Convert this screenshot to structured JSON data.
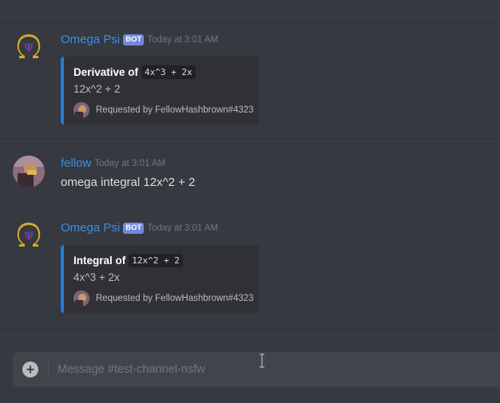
{
  "messages": [
    {
      "author": "Omega Psi",
      "badge": "BOT",
      "timestamp": "Today at 3:01 AM",
      "embed": {
        "title_prefix": "Derivative of",
        "title_code": "4x^3 + 2x",
        "description": "12x^2 + 2",
        "footer": "Requested by FellowHashbrown#4323"
      }
    },
    {
      "author": "fellow",
      "timestamp": "Today at 3:01 AM",
      "content": "omega integral 12x^2 + 2"
    },
    {
      "author": "Omega Psi",
      "badge": "BOT",
      "timestamp": "Today at 3:01 AM",
      "embed": {
        "title_prefix": "Integral of",
        "title_code": "12x^2 + 2",
        "description": "4x^3 + 2x",
        "footer": "Requested by FellowHashbrown#4323"
      }
    }
  ],
  "composer": {
    "placeholder": "Message #test-channel-nsfw",
    "add_icon": "+"
  },
  "colors": {
    "background": "#36393f",
    "author_blue": "#3a8ee6",
    "bot_badge": "#7289da",
    "embed_border": "#1e7fd8",
    "omega_gold": "#d6a82e"
  }
}
